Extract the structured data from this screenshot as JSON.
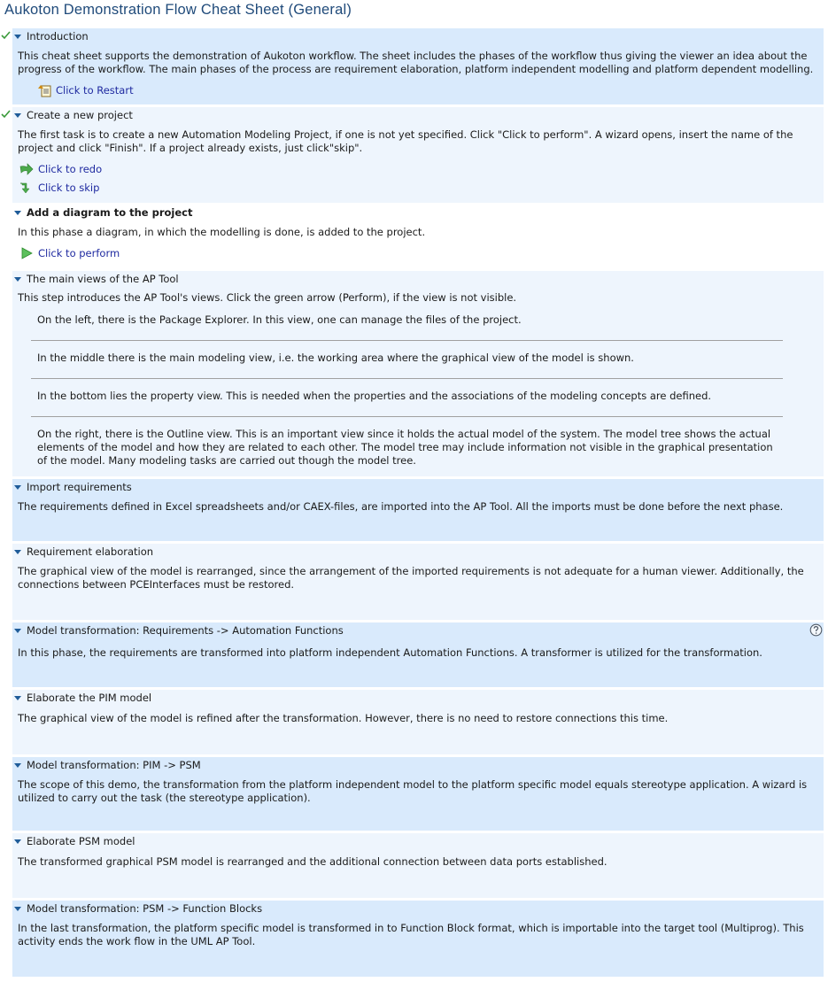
{
  "window": {
    "title": "Aukoton Demonstration Flow Cheat Sheet (General)"
  },
  "colors": {
    "completed_bg": "#d9eafc",
    "alt_bg": "#eef5fd",
    "current_bg": "#ffffff",
    "link": "#1f2aa0",
    "title": "#1f4a7a"
  },
  "sections": [
    {
      "title": "Introduction",
      "completed": true,
      "body": "This cheat sheet supports the demonstration of Aukoton workflow. The sheet includes the phases of the workflow thus giving the viewer an idea about the progress of the workflow. The main phases of the process are requirement elaboration, platform independent modelling and platform dependent modelling.",
      "actions": [
        {
          "label": "Click to Restart",
          "icon": "restart-icon"
        }
      ]
    },
    {
      "title": "Create a new project",
      "completed": true,
      "body": "The first task is to create a new Automation Modeling Project, if one is not yet specified. Click \"Click to perform\". A wizard opens, insert the name of the project and click \"Finish\". If a project already exists, just click\"skip\".",
      "actions": [
        {
          "label": "Click to redo",
          "icon": "redo-icon"
        },
        {
          "label": "Click to skip",
          "icon": "skip-icon"
        }
      ]
    },
    {
      "title": "Add a diagram to the project",
      "current": true,
      "body": "In this phase a diagram, in which the modelling is done, is added to the project.",
      "actions": [
        {
          "label": "Click to perform",
          "icon": "perform-icon"
        }
      ]
    },
    {
      "title": "The main views of the AP Tool",
      "body": "This step introduces the AP Tool's views. Click the green arrow (Perform), if the view is not visible.",
      "subitems": [
        "On the left, there is  the Package Explorer. In this view, one can manage the files of the project.",
        "In the middle there is the main modeling view, i.e. the working area where the graphical view of the model is shown.",
        "In the bottom lies the property view. This is needed when the properties and the associations of the modeling concepts are defined.",
        "On the right, there is the Outline view. This is an important view since it holds the actual model of the system. The model tree shows the actual elements of the model and how they are related to each other. The model tree may include information not visible in the graphical presentation of the model. Many modeling tasks are carried out though the model tree."
      ]
    },
    {
      "title": "Import requirements",
      "body": "The requirements defined in Excel spreadsheets and/or CAEX-files, are imported into the AP Tool. All the imports must be done before the next phase."
    },
    {
      "title": "Requirement elaboration",
      "body": "The graphical view of the model is rearranged, since the arrangement of the imported requirements is not adequate for a human viewer. Additionally, the connections between PCEInterfaces must be restored."
    },
    {
      "title": "Model transformation: Requirements -> Automation Functions",
      "has_help": true,
      "body": "In this phase, the requirements are transformed into platform independent Automation Functions. A transformer is utilized for the transformation."
    },
    {
      "title": "Elaborate the PIM model",
      "body": "The graphical view of the model is refined after the transformation. However, there is no need to restore connections this time."
    },
    {
      "title": "Model transformation: PIM -> PSM",
      "body": "The scope of this demo, the transformation from the platform independent model to the platform specific model equals stereotype application. A wizard is utilized to carry out the task (the stereotype application)."
    },
    {
      "title": "Elaborate PSM model",
      "body": "The transformed graphical PSM model is rearranged and the additional connection between data ports established."
    },
    {
      "title": "Model transformation: PSM -> Function Blocks",
      "body": "In the last transformation, the platform specific model is transformed in to Function Block format, which is importable into the target tool (Multiprog). This activity ends the work flow in the UML AP Tool."
    }
  ]
}
